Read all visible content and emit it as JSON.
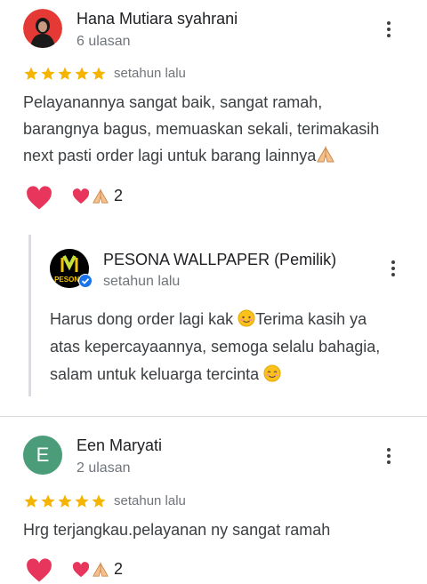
{
  "reviews": [
    {
      "author": "Hana Mutiara syahrani",
      "review_count": "6 ulasan",
      "rating": 5,
      "time": "setahun lalu",
      "text_lines": [
        "Pelayanannya sangat baik, sangat ramah,",
        "barangnya bagus, memuaskan sekali, terimakasih",
        "next pasti order lagi untuk barang lainnya"
      ],
      "reaction_count": "2",
      "reply": {
        "author": "PESONA WALLPAPER (Pemilik)",
        "time": "setahun lalu",
        "text_lines": [
          "Harus dong order lagi kak",
          "Terima kasih ya",
          "atas kepercayaannya, semoga selalu bahagia,",
          "salam untuk keluarga tercinta"
        ],
        "logo_text": "PESONA"
      }
    },
    {
      "author": "Een Maryati",
      "avatar_letter": "E",
      "review_count": "2 ulasan",
      "rating": 5,
      "time": "setahun lalu",
      "text_lines": [
        "Hrg terjangkau.pelayanan ny sangat ramah"
      ],
      "reaction_count": "2"
    }
  ],
  "colors": {
    "star": "#f4b400",
    "heart": "#e8355b",
    "avatar_green": "#4a9d78",
    "reply_bar": "#dadce0"
  },
  "icons": [
    "more-vert-icon",
    "star-icon",
    "heart-icon",
    "praying-hands-icon",
    "verified-badge-icon"
  ]
}
